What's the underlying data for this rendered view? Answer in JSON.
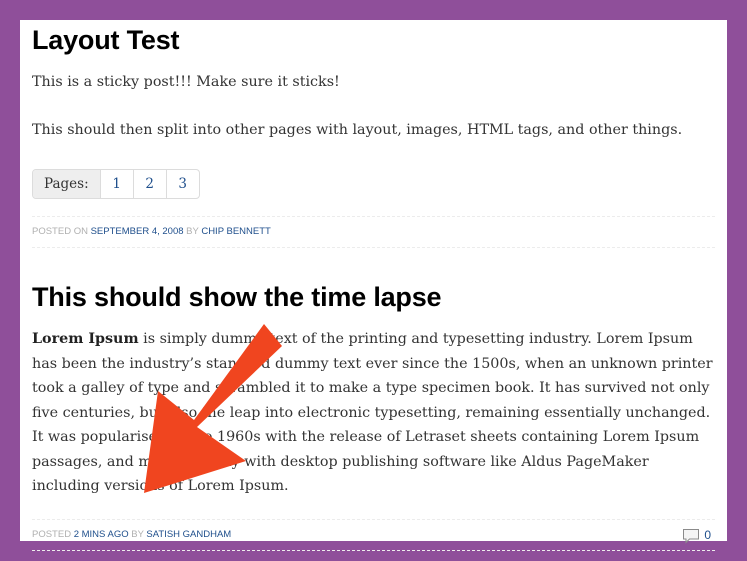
{
  "posts": [
    {
      "title": "Layout Test",
      "paragraphs": [
        "This is a sticky post!!! Make sure it sticks!",
        "This should then split into other pages with layout, images, HTML tags, and other things."
      ],
      "pagination": {
        "label": "Pages:",
        "pages": [
          "1",
          "2",
          "3"
        ]
      },
      "meta": {
        "posted_on": "Posted on",
        "date": "September 4, 2008",
        "by": "by",
        "author": "Chip Bennett"
      }
    },
    {
      "title": "This should show the time lapse",
      "body_bold": "Lorem Ipsum",
      "body_rest": " is simply dummy text of the printing and typesetting industry. Lorem Ipsum has been the industry’s standard dummy text ever since the 1500s, when an unknown printer took a galley of type and scrambled it to make a type specimen book. It has survived not only five centuries, but also the leap into electronic typesetting, remaining essentially unchanged. It was popularised in the 1960s with the release of Letraset sheets containing Lorem Ipsum passages, and more recently with desktop publishing software like Aldus PageMaker including versions of Lorem Ipsum.",
      "meta": {
        "posted": "Posted",
        "time": "2 mins ago",
        "by": "by",
        "author": "Satish Gandham",
        "comment_count": "0",
        "comment_icon": "speech-bubble-icon"
      }
    }
  ],
  "colors": {
    "frame": "#8f4f9a",
    "link": "#1f4f8c",
    "annotation_arrow": "#f0451f"
  }
}
